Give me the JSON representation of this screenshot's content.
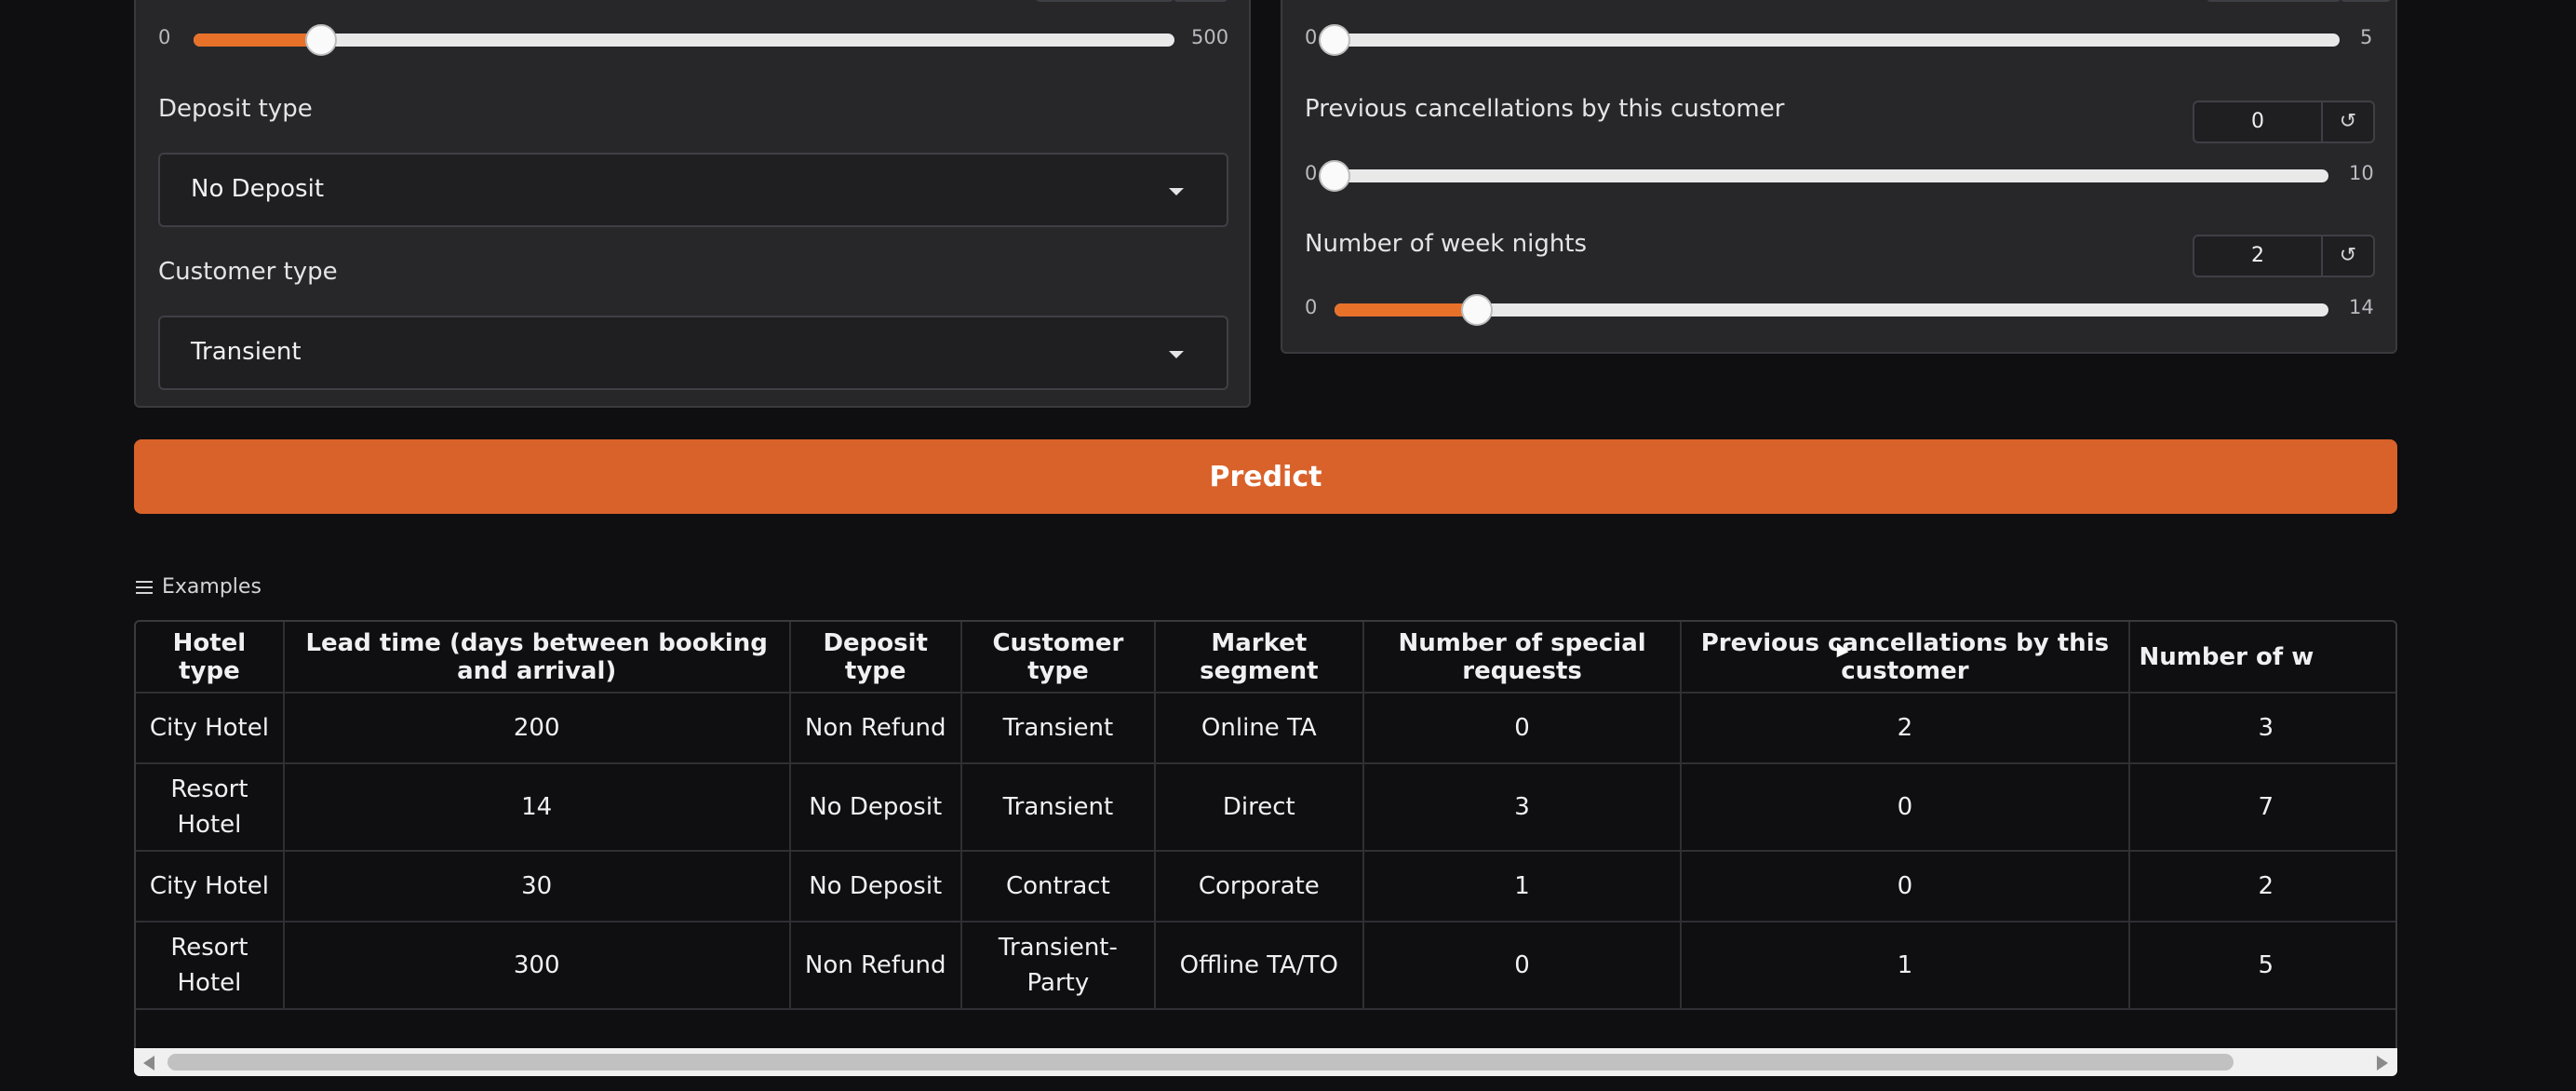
{
  "left_panel": {
    "slider_top": {
      "min": "0",
      "max": "500",
      "value_fraction": 0.13
    },
    "deposit_type": {
      "label": "Deposit type",
      "value": "No Deposit"
    },
    "customer_type": {
      "label": "Customer type",
      "value": "Transient"
    }
  },
  "right_panel": {
    "slider_top": {
      "min": "0",
      "max": "5",
      "value_fraction": 0.0
    },
    "prev_cancellations": {
      "label": "Previous cancellations by this customer",
      "value": "0",
      "min": "0",
      "max": "10",
      "value_fraction": 0.0
    },
    "week_nights": {
      "label": "Number of week nights",
      "value": "2",
      "min": "0",
      "max": "14",
      "value_fraction": 0.1429
    }
  },
  "predict_label": "Predict",
  "examples": {
    "title": "Examples",
    "columns": [
      "Hotel type",
      "Lead time (days between booking and arrival)",
      "Deposit type",
      "Customer type",
      "Market segment",
      "Number of special requests",
      "Previous cancellations by this customer",
      "Number of w"
    ],
    "rows": [
      [
        "City Hotel",
        "200",
        "Non Refund",
        "Transient",
        "Online TA",
        "0",
        "2",
        "3"
      ],
      [
        "Resort Hotel",
        "14",
        "No Deposit",
        "Transient",
        "Direct",
        "3",
        "0",
        "7"
      ],
      [
        "City Hotel",
        "30",
        "No Deposit",
        "Contract",
        "Corporate",
        "1",
        "0",
        "2"
      ],
      [
        "Resort Hotel",
        "300",
        "Non Refund",
        "Transient-Party",
        "Offline TA/TO",
        "0",
        "1",
        "5"
      ]
    ]
  },
  "icons": {
    "reset": "refresh-icon",
    "dropdown": "chevron-down-icon",
    "list": "list-icon"
  },
  "colors": {
    "accent": "#e8712a",
    "button": "#d9622b",
    "background": "#0f0f11",
    "panel": "#27272a"
  }
}
